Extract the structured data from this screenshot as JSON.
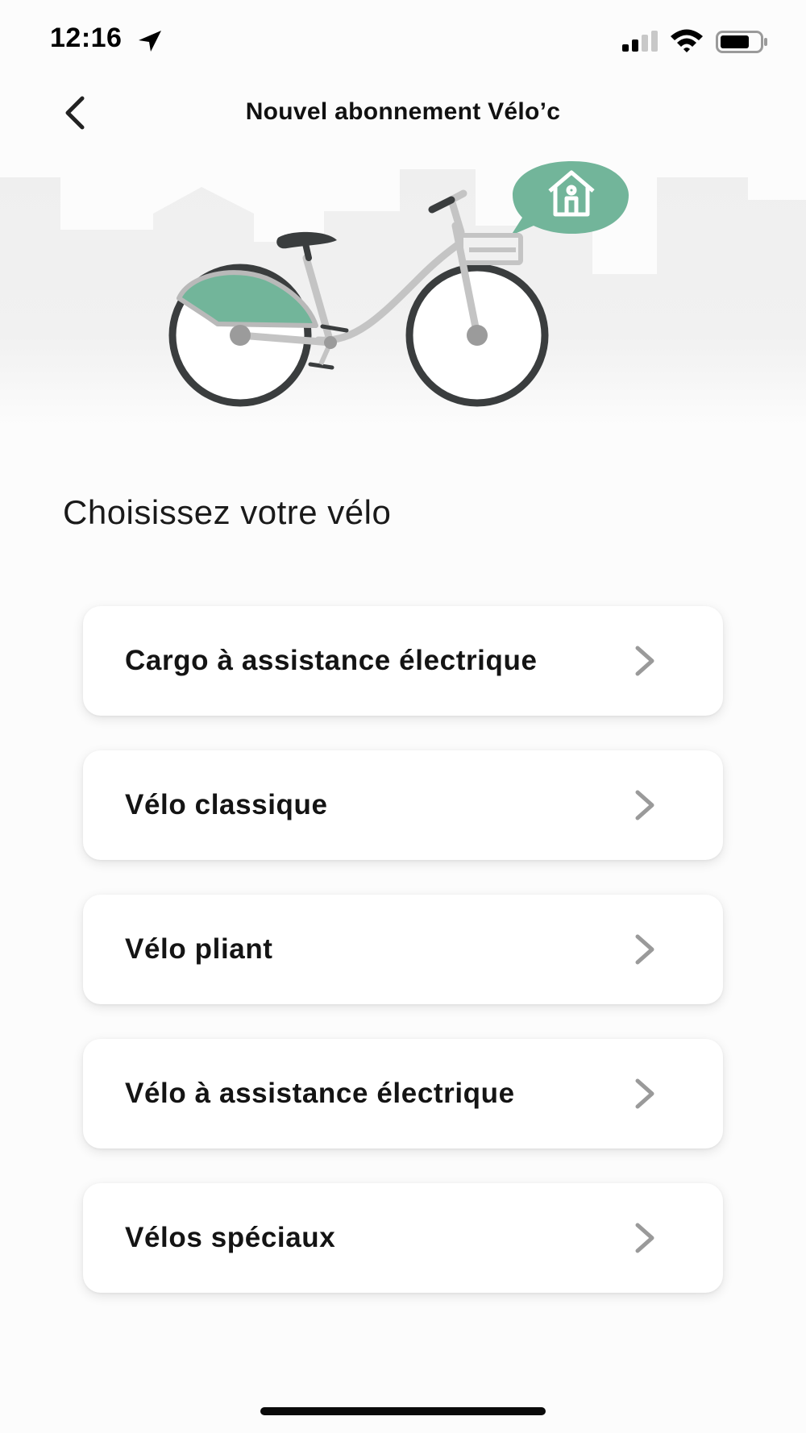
{
  "status_bar": {
    "time": "12:16",
    "icons": [
      "location-arrow-icon",
      "signal-icon",
      "wifi-icon",
      "battery-icon"
    ]
  },
  "header": {
    "back_icon": "chevron-left-icon",
    "title": "Nouvel abonnement Vélo’c"
  },
  "hero": {
    "illustration": "bicycle-illustration",
    "bubble_icon": "home-icon",
    "accent_color": "#72b59a"
  },
  "main": {
    "heading": "Choisissez votre vélo",
    "options": [
      {
        "label": "Cargo à assistance électrique",
        "icon": "chevron-right-icon"
      },
      {
        "label": "Vélo classique",
        "icon": "chevron-right-icon"
      },
      {
        "label": "Vélo pliant",
        "icon": "chevron-right-icon"
      },
      {
        "label": "Vélo à assistance électrique",
        "icon": "chevron-right-icon"
      },
      {
        "label": "Vélos spéciaux",
        "icon": "chevron-right-icon"
      }
    ]
  },
  "colors": {
    "accent": "#72b59a",
    "chevron": "#9a9a9a",
    "background": "#fcfcfc"
  }
}
